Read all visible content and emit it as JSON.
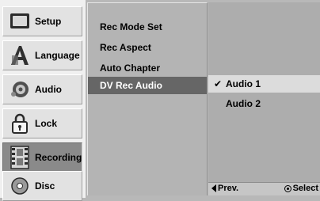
{
  "sidebar": {
    "tabs": [
      {
        "label": "Setup",
        "icon": "tv-icon",
        "selected": false
      },
      {
        "label": "Language",
        "icon": "language-icon",
        "selected": false
      },
      {
        "label": "Audio",
        "icon": "speaker-icon",
        "selected": false
      },
      {
        "label": "Lock",
        "icon": "lock-icon",
        "selected": false
      },
      {
        "label": "Recording",
        "icon": "film-icon",
        "selected": true
      },
      {
        "label": "Disc",
        "icon": "disc-icon",
        "selected": false
      }
    ]
  },
  "menu": {
    "items": [
      {
        "label": "Rec Mode Set",
        "selected": false
      },
      {
        "label": "Rec Aspect",
        "selected": false
      },
      {
        "label": "Auto Chapter",
        "selected": false
      },
      {
        "label": "DV Rec Audio",
        "selected": true
      }
    ]
  },
  "options": {
    "items": [
      {
        "label": "Audio 1",
        "checked": true,
        "check_glyph": "✔"
      },
      {
        "label": "Audio 2",
        "checked": false
      }
    ]
  },
  "footer": {
    "prev_label": "Prev.",
    "select_label": "Select"
  }
}
